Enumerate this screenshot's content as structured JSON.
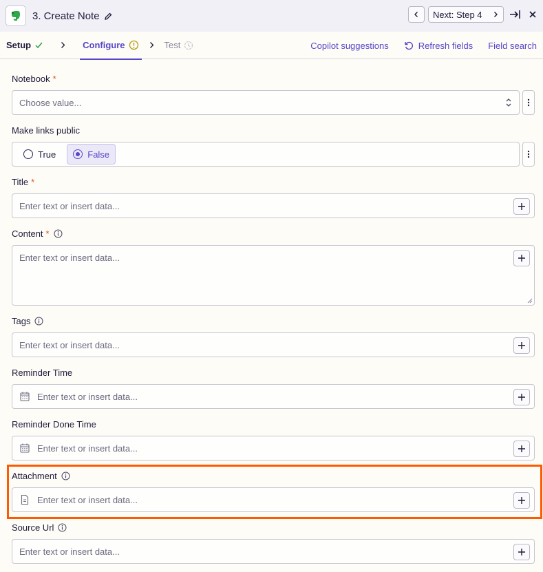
{
  "header": {
    "app_icon": "evernote-elephant-icon",
    "step_title": "3. Create Note",
    "next_label": "Next: Step 4"
  },
  "tabs": {
    "setup": "Setup",
    "configure": "Configure",
    "test": "Test",
    "copilot": "Copilot suggestions",
    "refresh": "Refresh fields",
    "field_search": "Field search"
  },
  "colors": {
    "accent": "#5746c9",
    "required": "#e2541d",
    "highlight": "#ff5a00",
    "check": "#2e9e4a"
  },
  "fields": {
    "notebook": {
      "label": "Notebook",
      "required": "*",
      "placeholder": "Choose value..."
    },
    "make_links_public": {
      "label": "Make links public",
      "option_true": "True",
      "option_false": "False",
      "selected": "False"
    },
    "title": {
      "label": "Title",
      "required": "*",
      "placeholder": "Enter text or insert data..."
    },
    "content": {
      "label": "Content",
      "required": "*",
      "placeholder": "Enter text or insert data..."
    },
    "tags": {
      "label": "Tags",
      "placeholder": "Enter text or insert data..."
    },
    "reminder_time": {
      "label": "Reminder Time",
      "placeholder": "Enter text or insert data..."
    },
    "reminder_done_time": {
      "label": "Reminder Done Time",
      "placeholder": "Enter text or insert data..."
    },
    "attachment": {
      "label": "Attachment",
      "placeholder": "Enter text or insert data..."
    },
    "source_url": {
      "label": "Source Url",
      "placeholder": "Enter text or insert data..."
    }
  }
}
